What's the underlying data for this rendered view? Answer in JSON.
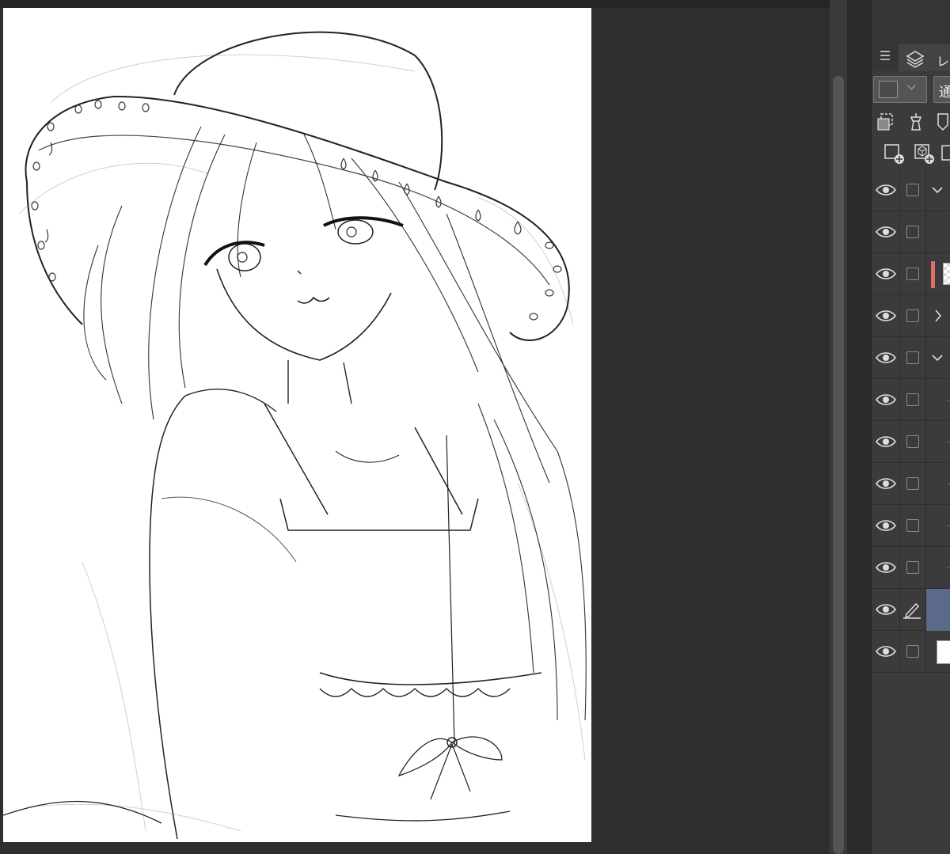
{
  "app": {
    "panel_tab_label": "レ",
    "blend_mode_label": "通"
  },
  "icons": {
    "menu": "menu-icon",
    "layers": "layers-stack-icon",
    "visibility": "eye-icon",
    "pen": "pen-icon"
  },
  "colors": {
    "canvas_bg": "#2f2f2f",
    "paper": "#ffffff",
    "panel_bg": "#3b3b3b",
    "selected_layer": "#5b6a8a",
    "color_label_red": "#e06b6b"
  }
}
